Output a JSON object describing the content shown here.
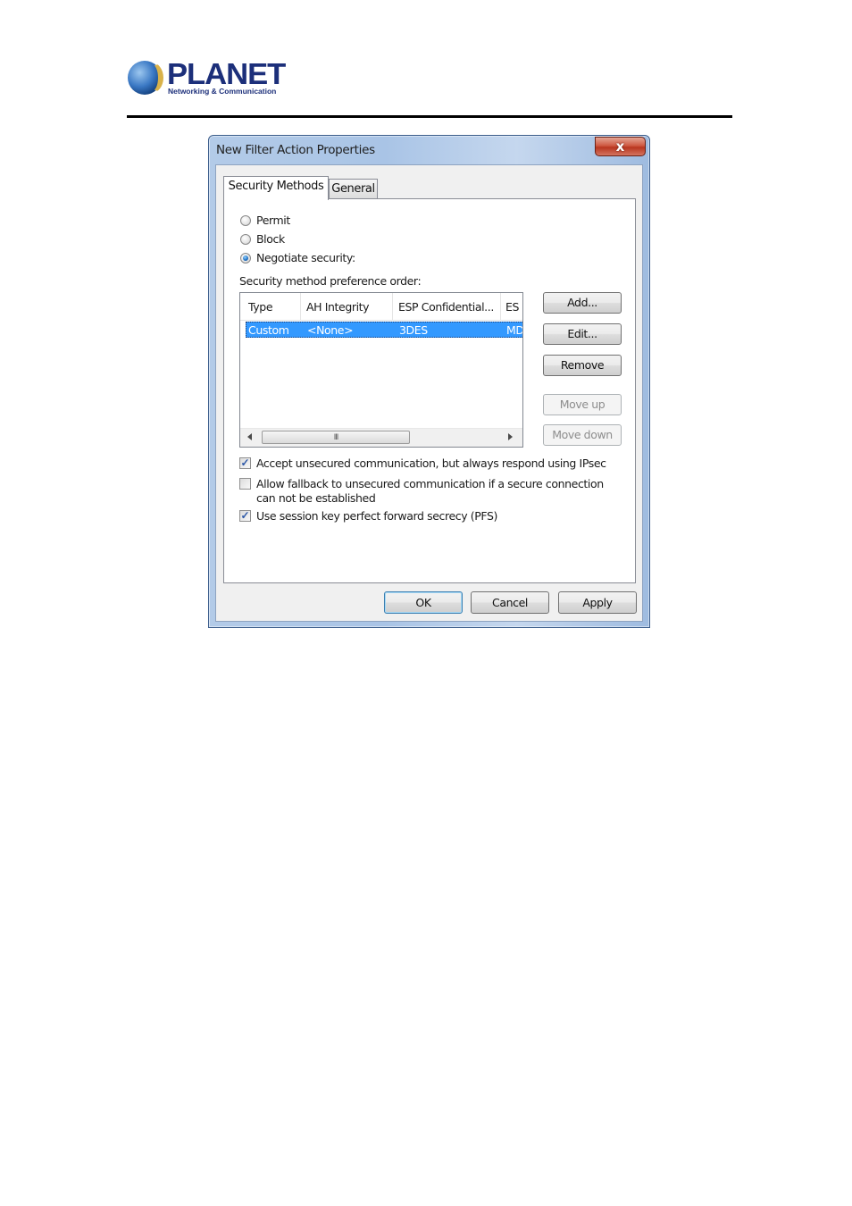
{
  "header": {
    "logo": {
      "brand": "PLANET",
      "tagline": "Networking & Communication"
    }
  },
  "dialog": {
    "title": "New Filter Action Properties",
    "close_glyph": "x",
    "tabs": [
      {
        "label": "Security Methods",
        "active": true
      },
      {
        "label": "General",
        "active": false
      }
    ],
    "radios": [
      {
        "label": "Permit",
        "selected": false
      },
      {
        "label": "Block",
        "selected": false
      },
      {
        "label": "Negotiate security:",
        "selected": true
      }
    ],
    "list_label": "Security method preference order:",
    "list": {
      "columns": [
        "Type",
        "AH Integrity",
        "ESP Confidential...",
        "ES"
      ],
      "rows": [
        {
          "cells": [
            "Custom",
            "<None>",
            "3DES",
            "MD"
          ],
          "selected": true
        }
      ],
      "scroll_grip": "III"
    },
    "side_buttons": [
      {
        "label": "Add...",
        "enabled": true
      },
      {
        "label": "Edit...",
        "enabled": true
      },
      {
        "label": "Remove",
        "enabled": true
      },
      {
        "label": "Move up",
        "enabled": false
      },
      {
        "label": "Move down",
        "enabled": false
      }
    ],
    "checkboxes": [
      {
        "label": "Accept unsecured communication, but always respond using IPsec",
        "checked": true
      },
      {
        "label": "Allow fallback to unsecured communication if a secure connection",
        "label2": "can not be established",
        "checked": false
      },
      {
        "label": "Use session key perfect forward secrecy (PFS)",
        "checked": true
      }
    ],
    "footer_buttons": {
      "ok": "OK",
      "cancel": "Cancel",
      "apply": "Apply"
    }
  }
}
